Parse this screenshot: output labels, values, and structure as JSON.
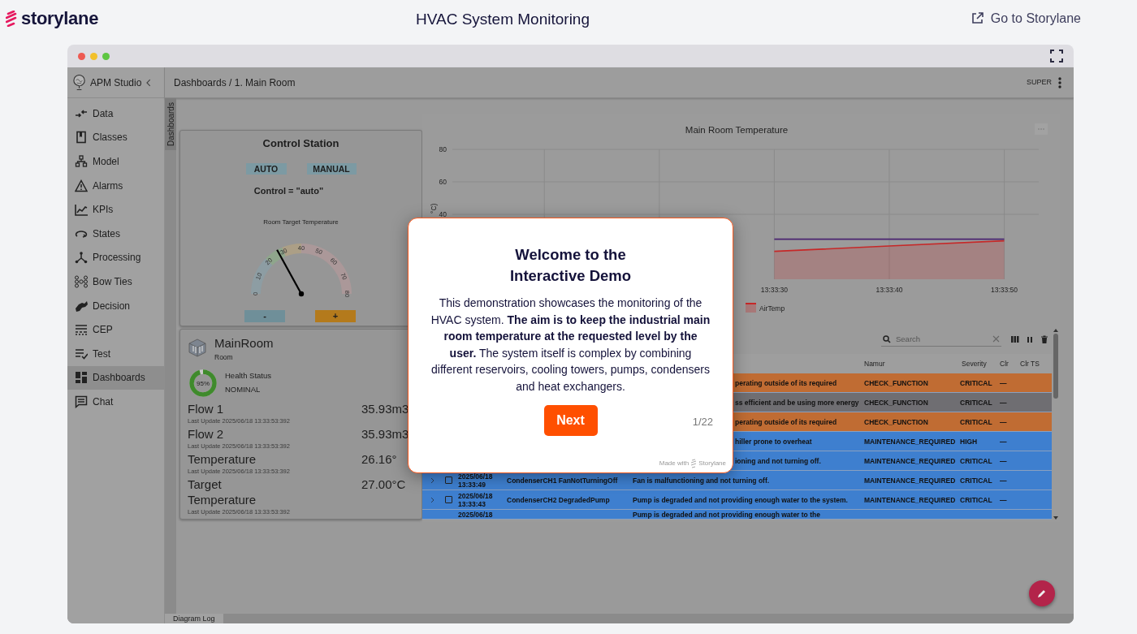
{
  "topbar": {
    "brand": "storylane",
    "title": "HVAC System Monitoring",
    "link": "Go to Storylane"
  },
  "app": {
    "name": "APM Studio",
    "breadcrumb": "Dashboards / 1. Main Room",
    "user": "SUPER"
  },
  "sidebar": {
    "items": [
      {
        "label": "Data",
        "selected": false
      },
      {
        "label": "Classes",
        "selected": false
      },
      {
        "label": "Model",
        "selected": false
      },
      {
        "label": "Alarms",
        "selected": false
      },
      {
        "label": "KPIs",
        "selected": false
      },
      {
        "label": "States",
        "selected": false
      },
      {
        "label": "Processing",
        "selected": false
      },
      {
        "label": "Bow Ties",
        "selected": false
      },
      {
        "label": "Decision",
        "selected": false
      },
      {
        "label": "CEP",
        "selected": false
      },
      {
        "label": "Test",
        "selected": false
      },
      {
        "label": "Dashboards",
        "selected": true
      },
      {
        "label": "Chat",
        "selected": false
      }
    ]
  },
  "side_tab": "Dashboards",
  "control_station": {
    "title": "Control Station",
    "modes": [
      "AUTO",
      "MANUAL"
    ],
    "status": "Control = \"auto\"",
    "gauge": {
      "label": "Room Target Temperature",
      "ticks": [
        "0",
        "10",
        "20",
        "30",
        "40",
        "50",
        "60",
        "70",
        "80"
      ],
      "level": 0.34
    },
    "steps": [
      "-",
      "+"
    ]
  },
  "room": {
    "name": "MainRoom",
    "type": "Room",
    "health": {
      "value": "95%",
      "level": 0.95,
      "label": "Health Status",
      "status": "NOMINAL"
    },
    "metrics": [
      {
        "label": "Flow 1",
        "value": "35.93m3",
        "updated": "Last Update 2025/06/18 13:33:53:392"
      },
      {
        "label": "Flow 2",
        "value": "35.93m3",
        "updated": "Last Update 2025/06/18 13:33:53:392"
      },
      {
        "label": "Temperature",
        "value": "26.16°",
        "updated": "Last Update 2025/06/18 13:33:53:392"
      },
      {
        "label": "Target Temperature",
        "value": "27.00°C",
        "updated": "Last Update 2025/06/18 13:33:53:392"
      }
    ]
  },
  "chart": {
    "chart_data": {
      "type": "area",
      "title": "Main Room Temperature",
      "ylabel": "°C)",
      "categories": [
        null,
        null,
        "13:33:30",
        "13:33:40",
        "13:33:50"
      ],
      "series": [
        {
          "name": "AirTemp",
          "color": "#c62828",
          "values": [
            null,
            null,
            17.2,
            20.5,
            23.7
          ]
        },
        {
          "color": "#4a2470",
          "type": "line",
          "values": [
            null,
            null,
            24.7,
            24.7,
            24.7
          ]
        }
      ],
      "ylim": [
        0,
        80
      ],
      "yticks": [
        40,
        60,
        80
      ],
      "grid": true
    }
  },
  "alarms": {
    "search": {
      "placeholder": "Search"
    },
    "columns": [
      "Namur",
      "Severity",
      "Clr",
      "Clr TS"
    ],
    "rows": [
      {
        "description": "perating outside of its required",
        "namur": "CHECK_FUNCTION",
        "severity": "CRITICAL",
        "clr": "—",
        "color": "#c06c33"
      },
      {
        "description": "ss efficient and be using more energy",
        "namur": "CHECK_FUNCTION",
        "severity": "CRITICAL",
        "clr": "—",
        "color": "#6f6e72"
      },
      {
        "description": "perating outside of its required",
        "namur": "CHECK_FUNCTION",
        "severity": "CRITICAL",
        "clr": "—",
        "color": "#c06c33"
      },
      {
        "description": "hiller prone to overheat",
        "namur": "MAINTENANCE_REQUIRED",
        "severity": "HIGH",
        "clr": "—",
        "color": "#3e7fcf"
      },
      {
        "description": "ioning and not turning off.",
        "namur": "MAINTENANCE_REQUIRED",
        "severity": "CRITICAL",
        "clr": "—",
        "color": "#3e7fcf"
      },
      {
        "checked": false,
        "time": "2025/06/18 13:33:49",
        "name": "CondenserCH1 FanNotTurningOff",
        "description": "Fan is malfunctioning and not turning off.",
        "namur": "MAINTENANCE_REQUIRED",
        "severity": "CRITICAL",
        "clr": "—",
        "color": "#3e7fcf"
      },
      {
        "checked": false,
        "time": "2025/06/18 13:33:43",
        "name": "CondenserCH2 DegradedPump",
        "description": "Pump is degraded and not providing enough water to the system.",
        "namur": "MAINTENANCE_REQUIRED",
        "severity": "CRITICAL",
        "clr": "—",
        "color": "#3e7fcf"
      },
      {
        "time": "2025/06/18",
        "description": "Pump is degraded and not providing enough water to the",
        "color": "#3e7fcf"
      }
    ]
  },
  "bottom_tab": "Diagram Log",
  "dialog": {
    "title": "Welcome to the Interactive Demo",
    "body": "This demonstration showcases the monitoring of the HVAC system. **The aim is to keep the industrial main room temperature at the requested level by the user.** The system itself is complex by combining different reservoirs, cooling towers, pumps, condensers and heat exchangers.",
    "button": "Next",
    "progress": "1/22",
    "made_with": "Made with",
    "brand": "Storylane"
  }
}
